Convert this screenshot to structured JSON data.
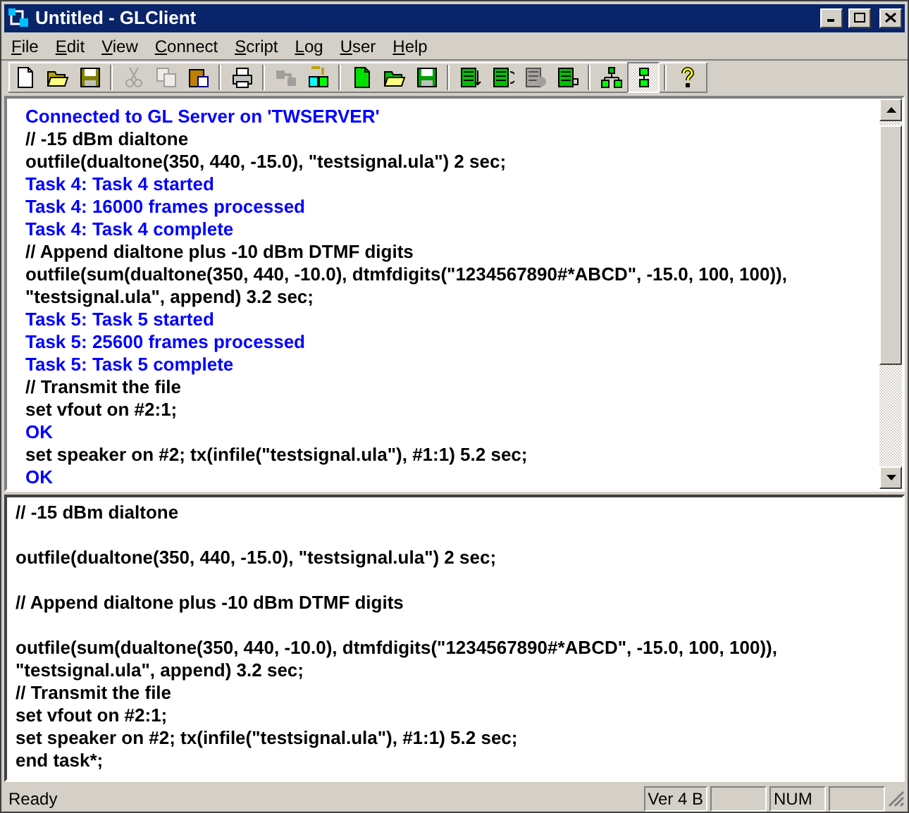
{
  "window": {
    "title": "Untitled - GLClient"
  },
  "menu": [
    {
      "label": "File"
    },
    {
      "label": "Edit"
    },
    {
      "label": "View"
    },
    {
      "label": "Connect"
    },
    {
      "label": "Script"
    },
    {
      "label": "Log"
    },
    {
      "label": "User"
    },
    {
      "label": "Help"
    }
  ],
  "toolbar": [
    [
      {
        "disabled": false,
        "pressed": false
      },
      {
        "disabled": false,
        "pressed": false
      },
      {
        "disabled": false,
        "pressed": false
      }
    ],
    [
      {
        "disabled": true,
        "pressed": false
      },
      {
        "disabled": true,
        "pressed": false
      },
      {
        "disabled": false,
        "pressed": false
      }
    ],
    [
      {
        "disabled": false,
        "pressed": false
      }
    ],
    [
      {
        "disabled": true,
        "pressed": false
      },
      {
        "disabled": false,
        "pressed": false
      }
    ],
    [
      {
        "disabled": false,
        "pressed": false
      },
      {
        "disabled": false,
        "pressed": false
      },
      {
        "disabled": false,
        "pressed": false
      }
    ],
    [
      {
        "disabled": false,
        "pressed": false
      },
      {
        "disabled": false,
        "pressed": false
      },
      {
        "disabled": true,
        "pressed": false
      },
      {
        "disabled": false,
        "pressed": false
      }
    ],
    [
      {
        "disabled": false,
        "pressed": false
      },
      {
        "disabled": false,
        "pressed": true
      }
    ],
    [
      {
        "disabled": false,
        "pressed": false
      }
    ]
  ],
  "log": [
    {
      "kind": "response",
      "text": "Connected to GL Server on 'TWSERVER'"
    },
    {
      "kind": "command",
      "text": "// -15 dBm dialtone"
    },
    {
      "kind": "command",
      "text": "outfile(dualtone(350, 440, -15.0), \"testsignal.ula\") 2 sec;"
    },
    {
      "kind": "response",
      "text": "Task 4: Task 4 started"
    },
    {
      "kind": "response",
      "text": "Task 4: 16000 frames processed"
    },
    {
      "kind": "response",
      "text": "Task 4: Task 4 complete"
    },
    {
      "kind": "command",
      "text": "// Append dialtone plus -10 dBm DTMF digits"
    },
    {
      "kind": "command",
      "text": "outfile(sum(dualtone(350, 440, -10.0), dtmfdigits(\"1234567890#*ABCD\", -15.0, 100, 100)),"
    },
    {
      "kind": "command",
      "text": "\"testsignal.ula\", append) 3.2 sec;"
    },
    {
      "kind": "response",
      "text": "Task 5: Task 5 started"
    },
    {
      "kind": "response",
      "text": "Task 5: 25600 frames processed"
    },
    {
      "kind": "response",
      "text": "Task 5: Task 5 complete"
    },
    {
      "kind": "command",
      "text": "// Transmit the file"
    },
    {
      "kind": "command",
      "text": "set vfout on #2:1;"
    },
    {
      "kind": "response",
      "text": "OK"
    },
    {
      "kind": "command",
      "text": "set speaker on #2; tx(infile(\"testsignal.ula\"), #1:1) 5.2 sec;"
    },
    {
      "kind": "response",
      "text": "OK"
    }
  ],
  "editor": {
    "paragraphs": [
      [
        "// -15 dBm dialtone"
      ],
      [
        "outfile(dualtone(350, 440, -15.0), \"testsignal.ula\") 2 sec;"
      ],
      [
        "// Append dialtone plus -10 dBm DTMF digits"
      ],
      [
        "outfile(sum(dualtone(350, 440, -10.0), dtmfdigits(\"1234567890#*ABCD\", -15.0, 100, 100)),",
        "\"testsignal.ula\", append) 3.2 sec;",
        "// Transmit the file",
        "set vfout on #2:1;",
        "set speaker on #2; tx(infile(\"testsignal.ula\"), #1:1) 5.2 sec;",
        "end task*;"
      ]
    ]
  },
  "status_bar": {
    "message": "Ready",
    "panes": [
      {
        "kind": "text",
        "label": "Ver 4 B"
      },
      {
        "kind": "blank"
      },
      {
        "kind": "text",
        "label": "NUM"
      },
      {
        "kind": "blank"
      }
    ]
  }
}
